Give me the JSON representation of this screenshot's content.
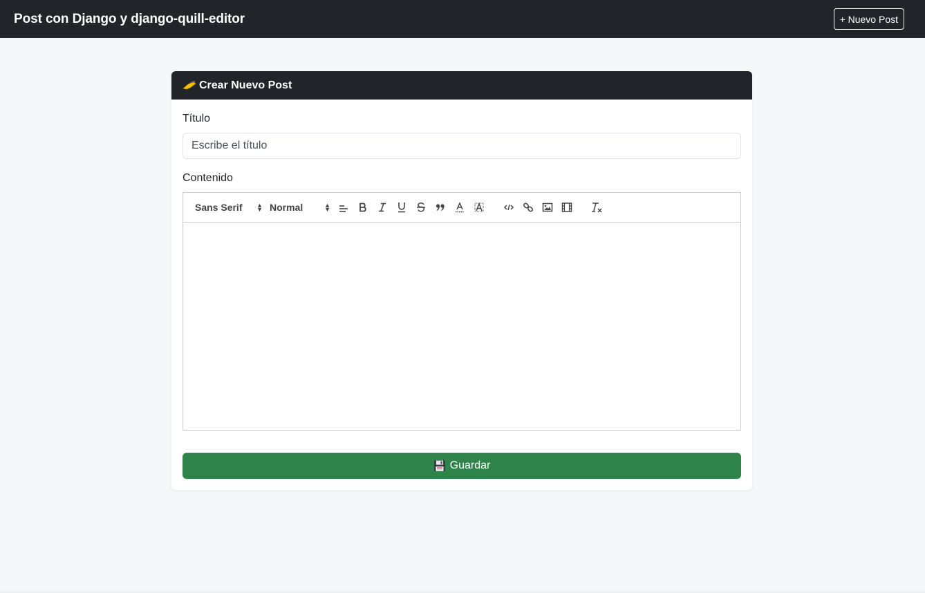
{
  "navbar": {
    "brand": "Post con Django y django-quill-editor",
    "new_post_label": "+ Nuevo Post"
  },
  "card": {
    "header_icon": "writing-hand-icon",
    "header_title": "Crear Nuevo Post",
    "title_label": "Título",
    "title_placeholder": "Escribe el título",
    "title_value": "",
    "content_label": "Contenido",
    "editor_content": ""
  },
  "toolbar": {
    "font_value": "Sans Serif",
    "size_value": "Normal",
    "buttons": [
      "align-icon",
      "bold-icon",
      "italic-icon",
      "underline-icon",
      "strike-icon",
      "blockquote-icon",
      "text-color-icon",
      "background-color-icon",
      "code-icon",
      "link-icon",
      "image-icon",
      "video-icon",
      "clean-format-icon"
    ]
  },
  "save": {
    "icon": "floppy-disk-icon",
    "label": "Guardar"
  },
  "colors": {
    "navbar_bg": "#212529",
    "save_bg": "#2e844a",
    "page_bg": "#f5f6f8"
  }
}
